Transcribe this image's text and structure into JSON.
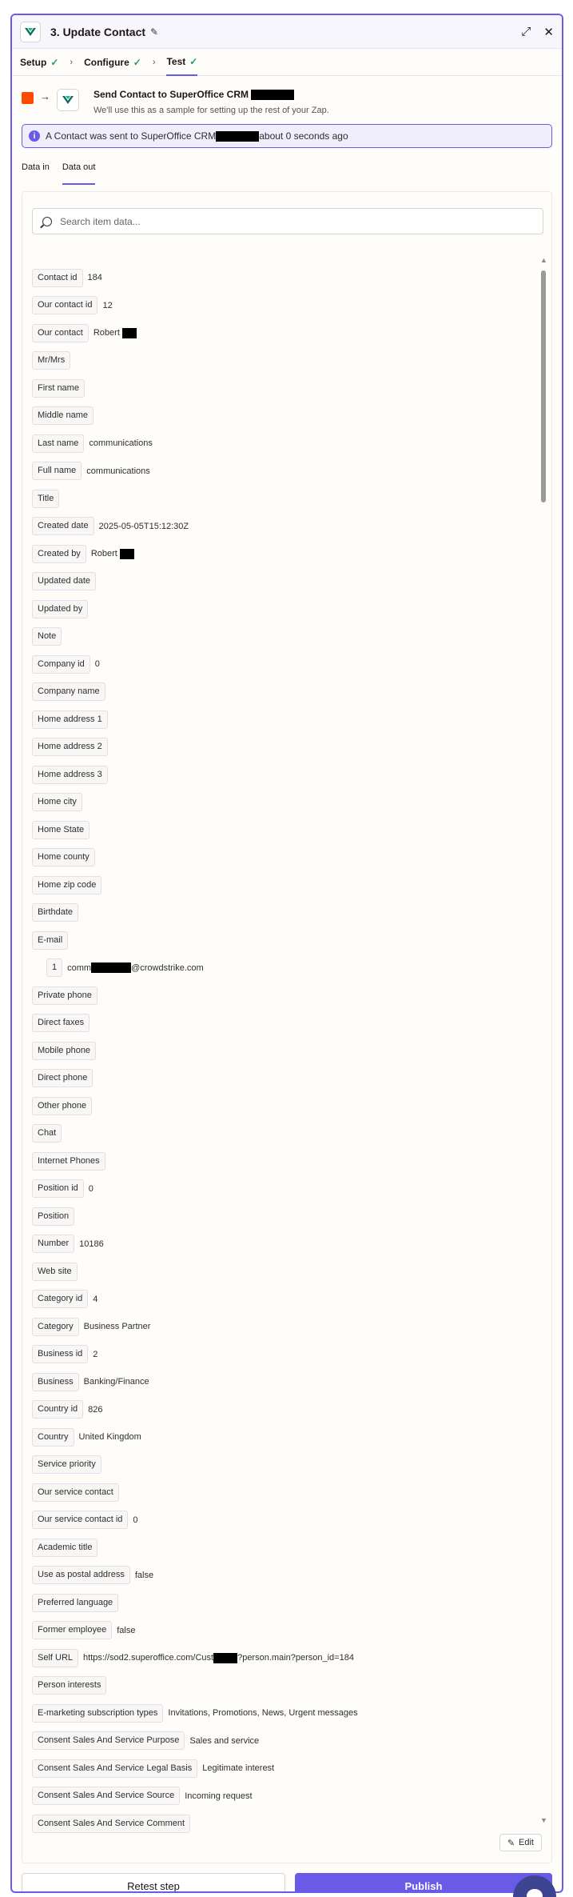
{
  "header": {
    "title": "3. Update Contact",
    "expand_icon": "expand-icon",
    "close_icon": "close-icon"
  },
  "steps": [
    {
      "label": "Setup"
    },
    {
      "label": "Configure"
    },
    {
      "label": "Test"
    }
  ],
  "action": {
    "title": "Send Contact to SuperOffice CRM",
    "subtitle": "We'll use this as a sample for setting up the rest of your Zap."
  },
  "info": {
    "prefix": "A Contact was sent to SuperOffice CRM",
    "suffix": "about 0 seconds ago"
  },
  "data_tabs": [
    "Data in",
    "Data out"
  ],
  "search": {
    "placeholder": "Search item data..."
  },
  "fields": [
    {
      "label": "Contact id",
      "value": "184"
    },
    {
      "label": "Our contact id",
      "value": "12"
    },
    {
      "label": "Our contact",
      "value": "Robert",
      "redacted": true
    },
    {
      "label": "Mr/Mrs",
      "value": ""
    },
    {
      "label": "First name",
      "value": ""
    },
    {
      "label": "Middle name",
      "value": ""
    },
    {
      "label": "Last name",
      "value": "communications"
    },
    {
      "label": "Full name",
      "value": "communications"
    },
    {
      "label": "Title",
      "value": ""
    },
    {
      "label": "Created date",
      "value": "2025-05-05T15:12:30Z"
    },
    {
      "label": "Created by",
      "value": "Robert",
      "redacted": true
    },
    {
      "label": "Updated date",
      "value": ""
    },
    {
      "label": "Updated by",
      "value": ""
    },
    {
      "label": "Note",
      "value": ""
    },
    {
      "label": "Company id",
      "value": "0"
    },
    {
      "label": "Company name",
      "value": ""
    },
    {
      "label": "Home address 1",
      "value": ""
    },
    {
      "label": "Home address 2",
      "value": ""
    },
    {
      "label": "Home address 3",
      "value": ""
    },
    {
      "label": "Home city",
      "value": ""
    },
    {
      "label": "Home State",
      "value": ""
    },
    {
      "label": "Home county",
      "value": ""
    },
    {
      "label": "Home zip code",
      "value": ""
    },
    {
      "label": "Birthdate",
      "value": ""
    },
    {
      "label": "E-mail",
      "value": ""
    },
    {
      "label": "1",
      "value": "comm",
      "value_after_redaction": "@crowdstrike.com",
      "nested": true
    },
    {
      "label": "Private phone",
      "value": ""
    },
    {
      "label": "Direct faxes",
      "value": ""
    },
    {
      "label": "Mobile phone",
      "value": ""
    },
    {
      "label": "Direct phone",
      "value": ""
    },
    {
      "label": "Other phone",
      "value": ""
    },
    {
      "label": "Chat",
      "value": ""
    },
    {
      "label": "Internet Phones",
      "value": ""
    },
    {
      "label": "Position id",
      "value": "0"
    },
    {
      "label": "Position",
      "value": ""
    },
    {
      "label": "Number",
      "value": "10186"
    },
    {
      "label": "Web site",
      "value": ""
    },
    {
      "label": "Category id",
      "value": "4"
    },
    {
      "label": "Category",
      "value": "Business Partner"
    },
    {
      "label": "Business id",
      "value": "2"
    },
    {
      "label": "Business",
      "value": "Banking/Finance"
    },
    {
      "label": "Country id",
      "value": "826"
    },
    {
      "label": "Country",
      "value": "United Kingdom"
    },
    {
      "label": "Service priority",
      "value": ""
    },
    {
      "label": "Our service contact",
      "value": ""
    },
    {
      "label": "Our service contact id",
      "value": "0"
    },
    {
      "label": "Academic title",
      "value": ""
    },
    {
      "label": "Use as postal address",
      "value": "false"
    },
    {
      "label": "Preferred language",
      "value": ""
    },
    {
      "label": "Former employee",
      "value": "false"
    },
    {
      "label": "Self URL",
      "value": "https://sod2.superoffice.com/Cust",
      "value_after_redaction": "?person.main?person_id=184"
    },
    {
      "label": "Person interests",
      "value": ""
    },
    {
      "label": "E-marketing subscription types",
      "value": "Invitations, Promotions, News, Urgent messages"
    },
    {
      "label": "Consent Sales And Service Purpose",
      "value": "Sales and service"
    },
    {
      "label": "Consent Sales And Service Legal Basis",
      "value": "Legitimate interest"
    },
    {
      "label": "Consent Sales And Service Source",
      "value": "Incoming request"
    },
    {
      "label": "Consent Sales And Service Comment",
      "value": ""
    }
  ],
  "buttons": {
    "edit": "Edit",
    "retest": "Retest step",
    "publish": "Publish"
  },
  "colors": {
    "accent": "#695be8",
    "success": "#1a9e63",
    "trigger": "#ff4a00",
    "chat": "#3d4592"
  }
}
